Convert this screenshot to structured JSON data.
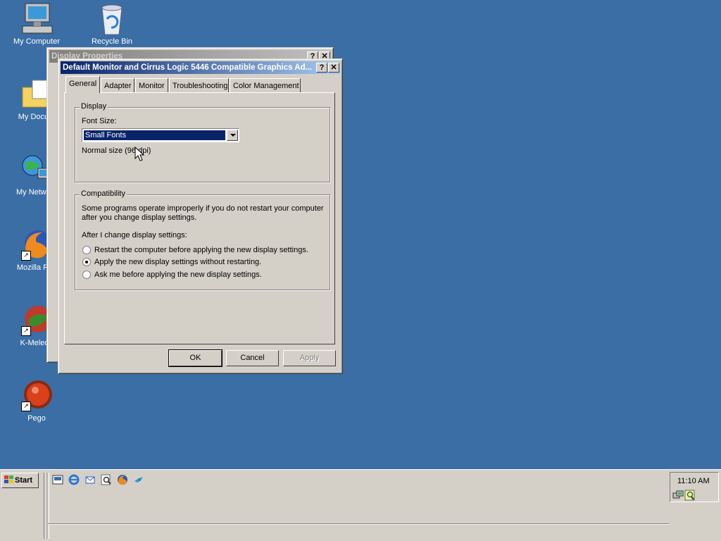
{
  "desktop": {
    "icons": [
      {
        "label": "My Computer"
      },
      {
        "label": "Recycle Bin"
      },
      {
        "label": "My Docum"
      },
      {
        "label": "My Network"
      },
      {
        "label": "Mozilla Fire"
      },
      {
        "label": "K-Meleon"
      },
      {
        "label": "Pego"
      }
    ]
  },
  "back_window": {
    "title": "Display Properties"
  },
  "dialog": {
    "title": "Default Monitor and Cirrus Logic 5446 Compatible Graphics Ad...",
    "tabs": [
      "General",
      "Adapter",
      "Monitor",
      "Troubleshooting",
      "Color Management"
    ],
    "display_group": {
      "label": "Display",
      "font_size_label": "Font Size:",
      "font_size_value": "Small Fonts",
      "normal_size_text": "Normal size (96 dpi)"
    },
    "compat_group": {
      "label": "Compatibility",
      "description_line1": "Some programs operate improperly if you do not restart your computer",
      "description_line2": "after you change display settings.",
      "after_change_label": "After I change display settings:",
      "options": [
        {
          "label": "Restart the computer before applying the new display settings.",
          "selected": false
        },
        {
          "label": "Apply the new display settings without restarting.",
          "selected": true
        },
        {
          "label": "Ask me before applying the new display settings.",
          "selected": false
        }
      ]
    },
    "buttons": {
      "ok": "OK",
      "cancel": "Cancel",
      "apply": "Apply"
    }
  },
  "taskbar": {
    "start_label": "Start",
    "clock": "11:10 AM"
  }
}
